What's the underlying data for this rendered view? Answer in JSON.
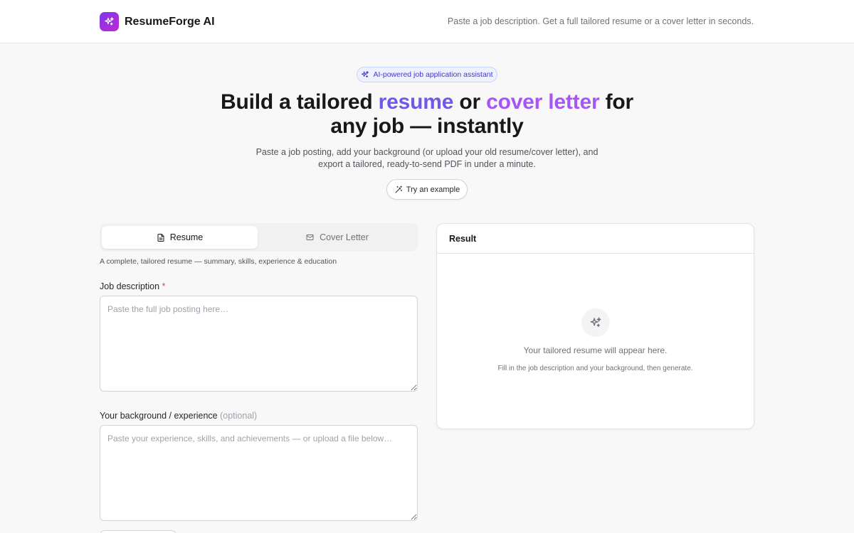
{
  "header": {
    "brand": "ResumeForge AI",
    "tagline": "Paste a job description. Get a full tailored resume or a cover letter in seconds.",
    "logo_icon": "sparkles-icon"
  },
  "hero": {
    "badge": "AI-powered job application assistant",
    "title_part1": "Build a tailored ",
    "title_highlight1": "resume",
    "title_part2": " or ",
    "title_highlight2": "cover letter",
    "title_part3": " for",
    "title_line2": "any job — instantly",
    "subtitle_line1": "Paste a job posting, add your background (or upload your old resume/cover letter), and",
    "subtitle_line2": "export a tailored, ready-to-send PDF in under a minute.",
    "try_button": "Try an example"
  },
  "tabs": [
    {
      "label": "Resume",
      "icon": "document-icon",
      "active": true
    },
    {
      "label": "Cover Letter",
      "icon": "mail-icon",
      "active": false
    }
  ],
  "form": {
    "mode_description": "A complete, tailored resume — summary, skills, experience & education",
    "job_description": {
      "label": "Job description",
      "required_marker": "*",
      "placeholder": "Paste the full job posting here…",
      "value": ""
    },
    "background": {
      "label": "Your background / experience",
      "optional_marker": "(optional)",
      "placeholder": "Paste your experience, skills, and achievements — or upload a file below…",
      "value": ""
    }
  },
  "result": {
    "title": "Result",
    "empty_title": "Your tailored resume will appear here.",
    "empty_subtitle": "Fill in the job description and your background, then generate.",
    "empty_icon": "sparkles-icon"
  },
  "colors": {
    "accent_start": "#7c3aed",
    "accent_end": "#c026d3",
    "highlight1": "#6d5ae6",
    "highlight2": "#a855f7",
    "required": "#ef4444"
  }
}
